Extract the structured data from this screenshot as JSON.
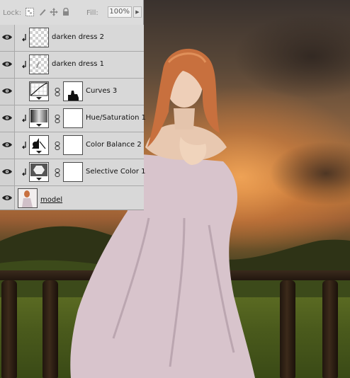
{
  "lock_bar": {
    "lock_label": "Lock:",
    "fill_label": "Fill:",
    "fill_value": "100%",
    "lock_icons": [
      "lock-transparent-icon",
      "lock-brush-icon",
      "lock-move-icon",
      "lock-all-icon"
    ]
  },
  "layers": [
    {
      "name": "darken dress 2",
      "clipped": true,
      "thumb": "transparent",
      "mask": false
    },
    {
      "name": "darken dress 1",
      "clipped": true,
      "thumb": "transparent-stroke",
      "mask": false
    },
    {
      "name": "Curves 3",
      "clipped": false,
      "thumb": "curves-adjustment-icon",
      "mask": "silhouette"
    },
    {
      "name": "Hue/Saturation 1",
      "clipped": true,
      "thumb": "hue-saturation-adjustment-icon",
      "mask": "white"
    },
    {
      "name": "Color Balance 2",
      "clipped": true,
      "thumb": "color-balance-adjustment-icon",
      "mask": "white"
    },
    {
      "name": "Selective Color 1",
      "clipped": true,
      "thumb": "selective-color-adjustment-icon",
      "mask": "white"
    },
    {
      "name": "model",
      "clipped": false,
      "thumb": "photo",
      "mask": false
    }
  ]
}
